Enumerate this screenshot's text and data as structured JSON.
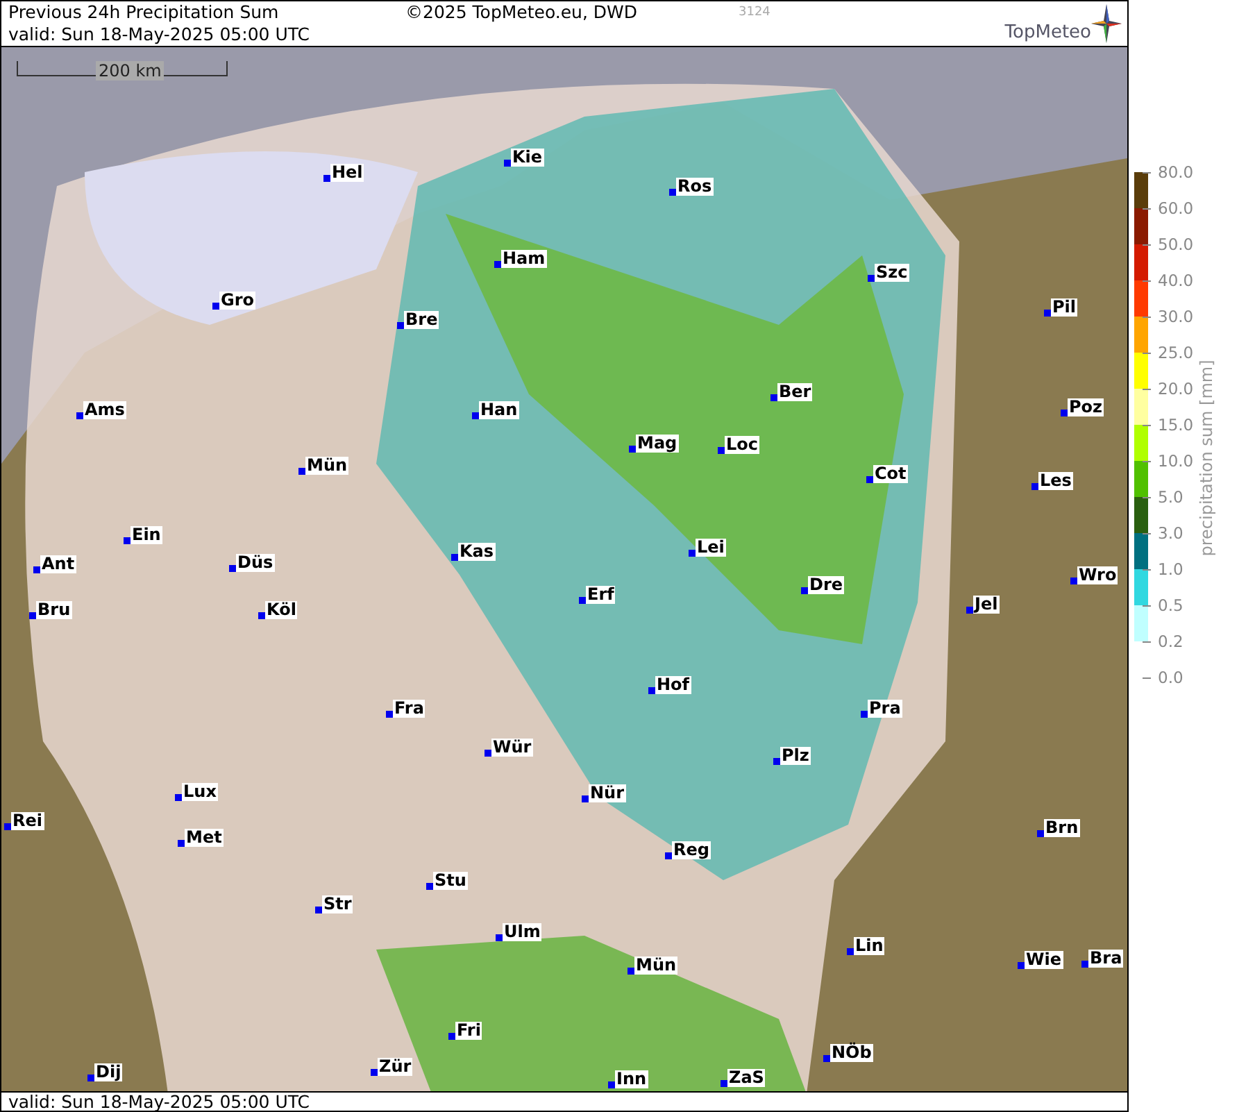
{
  "header": {
    "title": "Previous 24h Precipitation Sum",
    "valid": "valid:  Sun  18-May-2025 05:00 UTC",
    "copyright": "©2025 TopMeteo.eu, DWD",
    "code": "3124",
    "logo": "TopMeteo"
  },
  "scale_bar": {
    "label": "200 km"
  },
  "cities": [
    {
      "name": "Kie"
    },
    {
      "name": "Hel"
    },
    {
      "name": "Ros"
    },
    {
      "name": "Ham"
    },
    {
      "name": "Szc"
    },
    {
      "name": "Gro"
    },
    {
      "name": "Pil"
    },
    {
      "name": "Bre"
    },
    {
      "name": "Ber"
    },
    {
      "name": "Ams"
    },
    {
      "name": "Han"
    },
    {
      "name": "Poz"
    },
    {
      "name": "Mag"
    },
    {
      "name": "Loc"
    },
    {
      "name": "Mün"
    },
    {
      "name": "Cot"
    },
    {
      "name": "Les"
    },
    {
      "name": "Ein"
    },
    {
      "name": "Kas"
    },
    {
      "name": "Lei"
    },
    {
      "name": "Ant"
    },
    {
      "name": "Düs"
    },
    {
      "name": "Wro"
    },
    {
      "name": "Bru"
    },
    {
      "name": "Köl"
    },
    {
      "name": "Erf"
    },
    {
      "name": "Dre"
    },
    {
      "name": "Jel"
    },
    {
      "name": "Hof"
    },
    {
      "name": "Fra"
    },
    {
      "name": "Pra"
    },
    {
      "name": "Wür"
    },
    {
      "name": "Plz"
    },
    {
      "name": "Lux"
    },
    {
      "name": "Nür"
    },
    {
      "name": "Rei"
    },
    {
      "name": "Brn"
    },
    {
      "name": "Met"
    },
    {
      "name": "Reg"
    },
    {
      "name": "Stu"
    },
    {
      "name": "Str"
    },
    {
      "name": "Ulm"
    },
    {
      "name": "Lin"
    },
    {
      "name": "Wie"
    },
    {
      "name": "Bra"
    },
    {
      "name": "Mün"
    },
    {
      "name": "Fri"
    },
    {
      "name": "NÖb"
    },
    {
      "name": "Dij"
    },
    {
      "name": "Zür"
    },
    {
      "name": "Inn"
    },
    {
      "name": "ZaS"
    }
  ],
  "legend": {
    "title": "precipitation sum [mm]",
    "steps": [
      {
        "label": "80.0",
        "color": "#5a3d0a"
      },
      {
        "label": "60.0",
        "color": "#8b1a00"
      },
      {
        "label": "50.0",
        "color": "#d41a00"
      },
      {
        "label": "40.0",
        "color": "#ff3a00"
      },
      {
        "label": "30.0",
        "color": "#ffa500"
      },
      {
        "label": "25.0",
        "color": "#ffff00"
      },
      {
        "label": "20.0",
        "color": "#ffffa0"
      },
      {
        "label": "15.0",
        "color": "#b0ff00"
      },
      {
        "label": "10.0",
        "color": "#50c000"
      },
      {
        "label": "5.0",
        "color": "#2a6010"
      },
      {
        "label": "3.0",
        "color": "#007080"
      },
      {
        "label": "1.0",
        "color": "#30d8e0"
      },
      {
        "label": "0.5",
        "color": "#c0ffff"
      },
      {
        "label": "0.2"
      },
      {
        "label": "0.0"
      }
    ]
  },
  "footer": {
    "valid": "valid:  Sun  18-May-2025 05:00 UTC"
  }
}
